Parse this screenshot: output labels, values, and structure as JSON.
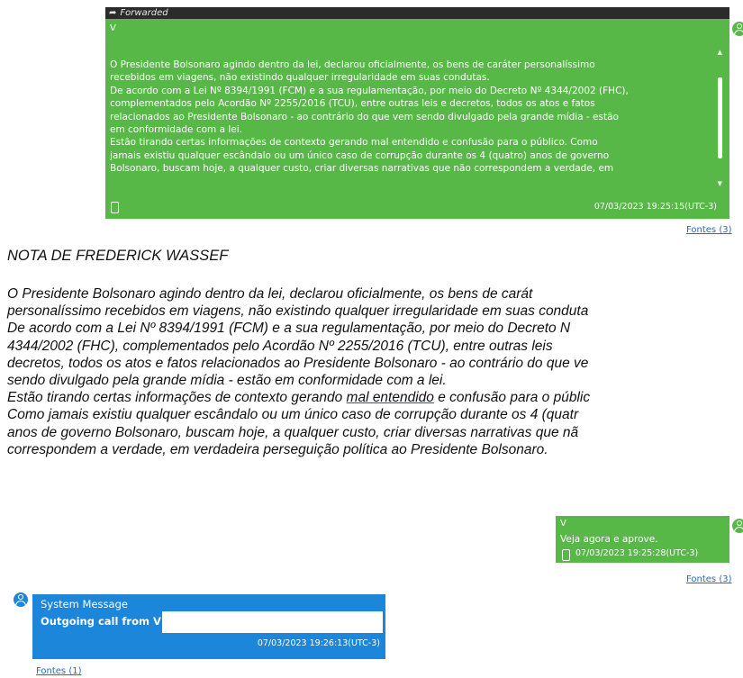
{
  "forwarded_message": {
    "header_label": "Forwarded",
    "sender": "V",
    "paragraphs": [
      "O Presidente Bolsonaro agindo dentro da lei, declarou oficialmente, os bens de caráter personalíssimo",
      "recebidos em viagens, não existindo qualquer irregularidade em suas condutas.",
      "De acordo com a Lei Nº 8394/1991 (FCM) e a sua regulamentação, por meio do Decreto Nº 4344/2002 (FHC),",
      "complementados pelo Acordão Nº 2255/2016 (TCU), entre outras leis e decretos, todos os atos e fatos",
      "relacionados ao Presidente Bolsonaro - ao contrário do que vem sendo divulgado pela grande mídia - estão",
      "em conformidade com a lei.",
      "Estão tirando certas informações de contexto gerando mal entendido e confusão para o público. Como",
      "jamais existiu qualquer escândalo ou um único caso de corrupção durante os 4 (quatro) anos de governo",
      "Bolsonaro, buscam hoje, a qualquer custo, criar diversas narrativas que não correspondem a verdade, em"
    ],
    "timestamp": "07/03/2023 19:25:15(UTC-3)",
    "sources_link": "Fontes (3)"
  },
  "note": {
    "title": "NOTA DE FREDERICK WASSEF",
    "lines": [
      "O Presidente Bolsonaro agindo dentro da lei, declarou oficialmente, os bens de carát",
      "personalíssimo recebidos em viagens, não existindo qualquer irregularidade em suas conduta",
      "De acordo com a Lei Nº 8394/1991 (FCM) e a sua regulamentação, por meio do Decreto N",
      "4344/2002 (FHC), complementados pelo Acordão Nº 2255/2016 (TCU), entre outras leis",
      "decretos, todos os atos e fatos relacionados ao Presidente Bolsonaro - ao contrário do que ve",
      "sendo divulgado pela grande mídia - estão em conformidade com a lei."
    ],
    "line7_before": "Estão tirando certas informações de contexto gerando ",
    "line7_underlined": "mal entendido",
    "line7_after": " e confusão para o públic",
    "lines_tail": [
      "Como jamais existiu qualquer escândalo ou um único caso de corrupção durante os 4 (quatr",
      "anos de governo Bolsonaro, buscam hoje, a qualquer custo, criar diversas narrativas que nã",
      "correspondem a verdade, em verdadeira perseguição política ao Presidente Bolsonaro."
    ]
  },
  "second_message": {
    "sender": "V",
    "text": "Veja agora e aprove.",
    "timestamp": "07/03/2023 19:25:28(UTC-3)",
    "sources_link": "Fontes (3)"
  },
  "system_message": {
    "title": "System Message",
    "text": "Outgoing call from V",
    "timestamp": "07/03/2023 19:26:13(UTC-3)",
    "sources_link": "Fontes (1)"
  },
  "colors": {
    "message_green": "#57b848",
    "system_blue": "#1c86da",
    "header_dark": "#2b2b2b",
    "link_blue": "#2a6bb8"
  },
  "icons": [
    "forward-arrow-icon",
    "phone-icon",
    "avatar-icon",
    "scroll-up-icon",
    "scroll-down-icon"
  ]
}
